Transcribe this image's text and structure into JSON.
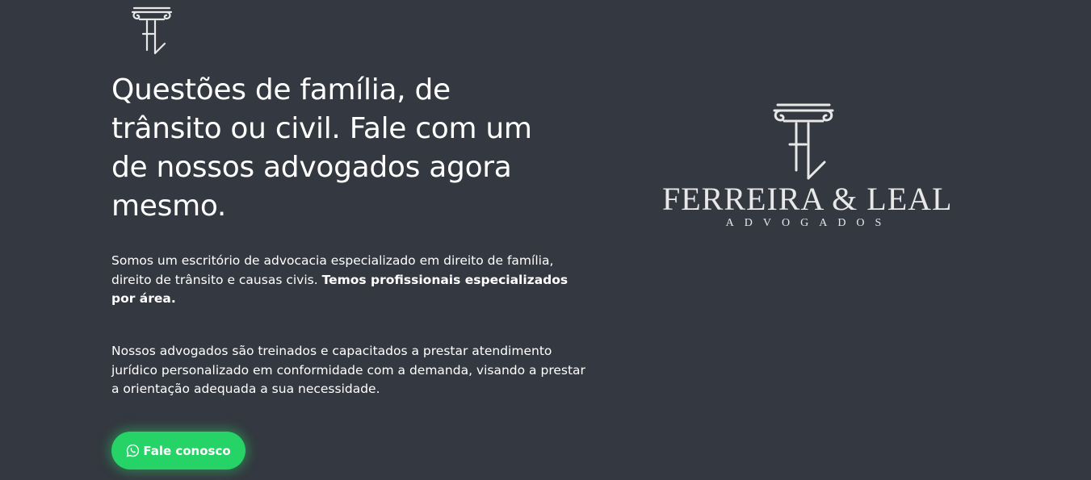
{
  "header": {
    "logo_icon": "column-monogram-icon"
  },
  "hero": {
    "headline": "Questões de família, de trânsito ou civil. Fale com um de nossos advogados agora mesmo.",
    "paragraph1": {
      "text": "Somos um escritório de advocacia especializado em direito de família, direito de trânsito e causas civis. ",
      "bold": "Temos profissionais especializados por área."
    },
    "paragraph2": "Nossos advogados são treinados e capacitados a prestar atendimento jurídico personalizado em conformidade com a demanda, visando a prestar a orientação adequada a sua necessidade.",
    "cta": {
      "label": "Fale conosco",
      "icon": "whatsapp-icon",
      "color": "#25d366"
    }
  },
  "brand": {
    "icon": "column-monogram-icon",
    "name": "FERREIRA & LEAL",
    "subtitle": "ADVOGADOS"
  },
  "colors": {
    "background": "#343840",
    "text": "#ffffff",
    "logo": "#e8e8e8"
  }
}
